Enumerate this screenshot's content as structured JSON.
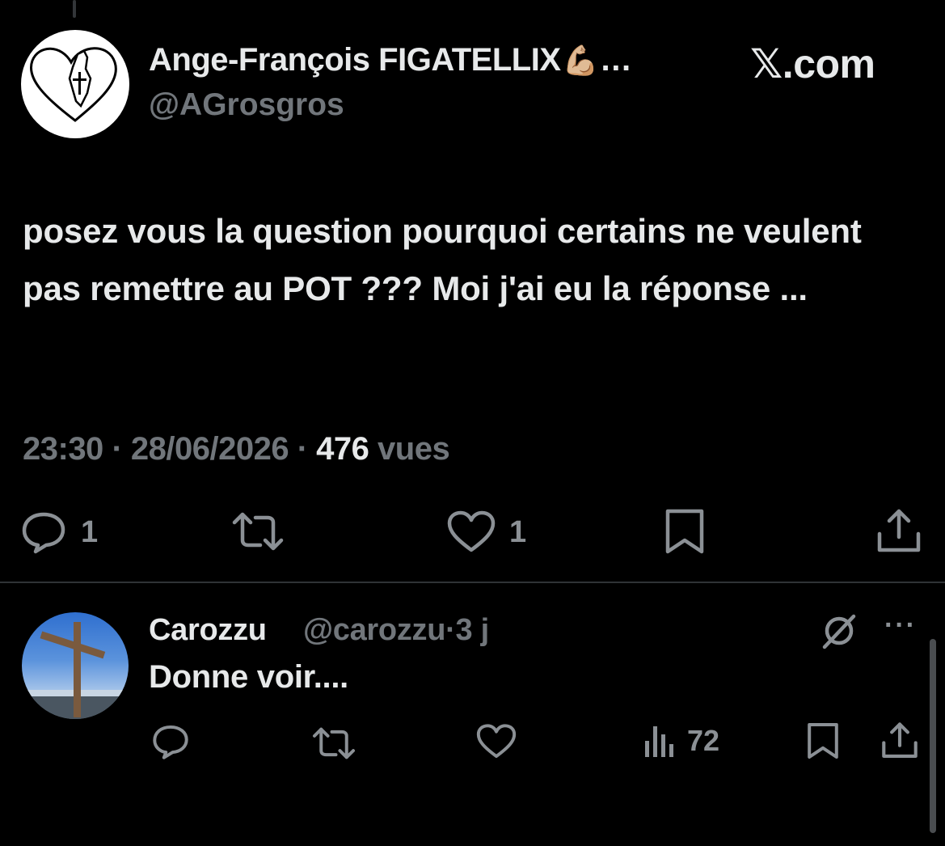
{
  "tweet": {
    "author": {
      "display_name": "Ange-François FIGATELLIX",
      "emoji": "💪🏼",
      "ellipsis": "…",
      "handle": "@AGrosgros"
    },
    "brand": {
      "glyph": "𝕏",
      "suffix": ".com"
    },
    "text": "posez vous la question pourquoi certains ne veulent pas remettre au POT ??? Moi j'ai eu la réponse ...",
    "time": "23:30",
    "date": "28/06/2026",
    "separator": "·",
    "views_count": "476",
    "views_label": "vues",
    "actions": {
      "replies": "1",
      "likes": "1"
    }
  },
  "reply": {
    "display_name": "Carozzu",
    "handle": "@carozzu",
    "separator": "·",
    "age": "3 j",
    "text": "Donne voir....",
    "more": "···",
    "views": "72"
  },
  "icons": {
    "reply": "comment-icon",
    "retweet": "retweet-icon",
    "like": "heart-icon",
    "bookmark": "bookmark-icon",
    "share": "share-icon",
    "views": "analytics-icon",
    "grok": "grok-icon",
    "more": "more-icon"
  },
  "colors": {
    "background": "#000000",
    "text_primary": "#e7e9ea",
    "text_secondary": "#71767b",
    "divider": "#2f3336"
  }
}
